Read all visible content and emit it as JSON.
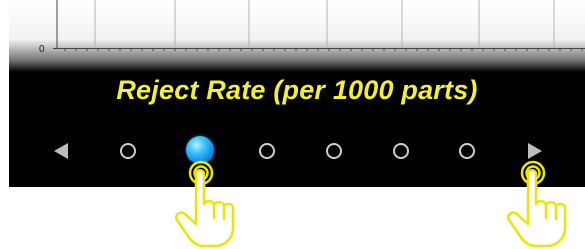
{
  "chart": {
    "y_tick_label": "0"
  },
  "title": "Reject Rate (per 1000 parts)",
  "pagination": {
    "page_count": 6,
    "active_page": 2,
    "prev_icon": "triangle-left-icon",
    "next_icon": "triangle-right-icon"
  },
  "colors": {
    "panel_bg": "#000000",
    "title": "#f2ee3c",
    "active_dot": "#1a9ef0",
    "inactive_dot": "#cfcfcf",
    "arrow": "#bdbdbd",
    "hand_outline": "#e9e600",
    "hand_fill": "#ffffff"
  }
}
